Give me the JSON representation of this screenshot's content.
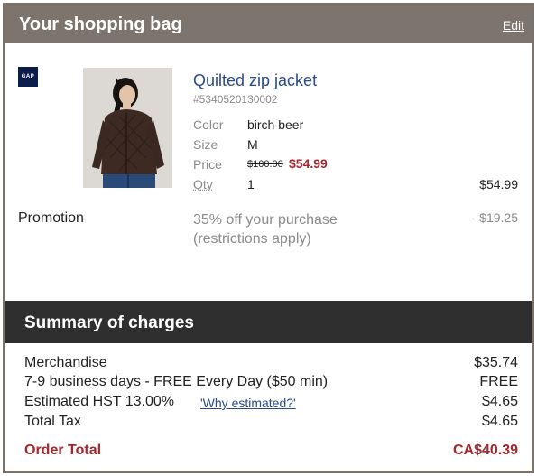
{
  "bag": {
    "title": "Your shopping bag",
    "edit_label": "Edit"
  },
  "brand": {
    "logo_text": "GAP",
    "logo_color": "#0b1e4b"
  },
  "item": {
    "name": "Quilted zip jacket",
    "sku": "#5340520130002",
    "color_label": "Color",
    "color_value": "birch beer",
    "size_label": "Size",
    "size_value": "M",
    "price_label": "Price",
    "price_original": "$100.00",
    "price_sale": "$54.99",
    "qty_label": "Qty",
    "qty_value": "1",
    "line_total": "$54.99"
  },
  "promotion": {
    "label": "Promotion",
    "description": "35% off your purchase (restrictions apply)",
    "amount": "–$19.25"
  },
  "summary": {
    "title": "Summary of charges",
    "merchandise_label": "Merchandise",
    "merchandise_value": "$35.74",
    "shipping_label": "7-9 business days - FREE Every Day ($50 min)",
    "shipping_value": "FREE",
    "hst_label": "Estimated HST 13.00%",
    "why_link": "'Why estimated?'",
    "hst_value": "$4.65",
    "tax_label": "Total Tax",
    "tax_value": "$4.65",
    "order_total_label": "Order Total",
    "order_total_value": "CA$40.39"
  },
  "colors": {
    "header_bg": "#7d756d",
    "summary_bg": "#2f2f2f",
    "accent_red": "#a0282e",
    "link_blue": "#2b4a8b"
  }
}
